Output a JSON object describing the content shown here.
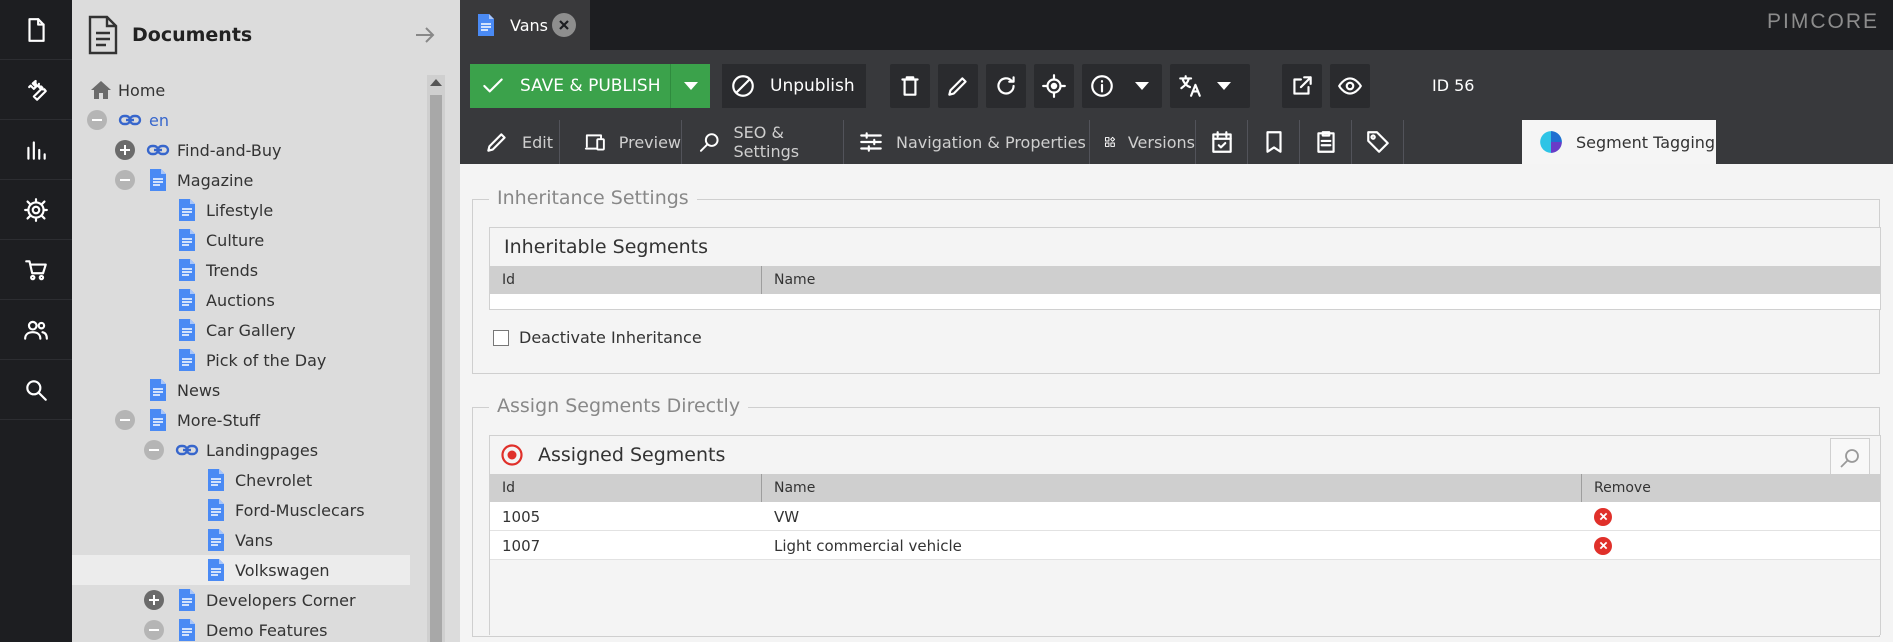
{
  "rail": {
    "items": [
      {
        "name": "documents"
      },
      {
        "name": "tools"
      },
      {
        "name": "marketing"
      },
      {
        "name": "settings"
      },
      {
        "name": "ecommerce"
      },
      {
        "name": "users"
      },
      {
        "name": "search"
      }
    ]
  },
  "tree": {
    "title": "Documents",
    "items": [
      {
        "label": "Home",
        "icon": "home-icon",
        "expander": "none",
        "depth": 0,
        "kind": "home"
      },
      {
        "label": "en",
        "icon": "link-icon",
        "expander": "minus",
        "depth": 0,
        "kind": "link"
      },
      {
        "label": "Find-and-Buy",
        "icon": "link-icon",
        "expander": "plus",
        "depth": 1,
        "kind": "link-dark"
      },
      {
        "label": "Magazine",
        "icon": "page-icon",
        "expander": "minus",
        "depth": 1,
        "kind": "page"
      },
      {
        "label": "Lifestyle",
        "icon": "page-icon",
        "expander": "none",
        "depth": 2,
        "kind": "page"
      },
      {
        "label": "Culture",
        "icon": "page-icon",
        "expander": "none",
        "depth": 2,
        "kind": "page"
      },
      {
        "label": "Trends",
        "icon": "page-icon",
        "expander": "none",
        "depth": 2,
        "kind": "page"
      },
      {
        "label": "Auctions",
        "icon": "page-icon",
        "expander": "none",
        "depth": 2,
        "kind": "page"
      },
      {
        "label": "Car Gallery",
        "icon": "page-icon",
        "expander": "none",
        "depth": 2,
        "kind": "page"
      },
      {
        "label": "Pick of the Day",
        "icon": "page-icon",
        "expander": "none",
        "depth": 2,
        "kind": "page"
      },
      {
        "label": "News",
        "icon": "page-icon",
        "expander": "none",
        "depth": 1,
        "kind": "page"
      },
      {
        "label": "More-Stuff",
        "icon": "page-icon",
        "expander": "minus",
        "depth": 1,
        "kind": "page"
      },
      {
        "label": "Landingpages",
        "icon": "link-icon",
        "expander": "minus",
        "depth": 2,
        "kind": "link-dark"
      },
      {
        "label": "Chevrolet",
        "icon": "page-icon",
        "expander": "none",
        "depth": 3,
        "kind": "page"
      },
      {
        "label": "Ford-Musclecars",
        "icon": "page-icon",
        "expander": "none",
        "depth": 3,
        "kind": "page"
      },
      {
        "label": "Vans",
        "icon": "page-icon",
        "expander": "none",
        "depth": 3,
        "kind": "page"
      },
      {
        "label": "Volkswagen",
        "icon": "page-icon",
        "expander": "none",
        "depth": 3,
        "kind": "page",
        "selected": true
      },
      {
        "label": "Developers Corner",
        "icon": "page-icon",
        "expander": "plus",
        "depth": 2,
        "kind": "page"
      },
      {
        "label": "Demo Features",
        "icon": "page-icon",
        "expander": "minus",
        "depth": 2,
        "kind": "page"
      }
    ]
  },
  "header": {
    "tab_label": "Vans",
    "logo": "PIMCORE"
  },
  "toolbar": {
    "save_label": "SAVE & PUBLISH",
    "unpublish_label": "Unpublish",
    "id_label": "ID 56"
  },
  "subtabs": {
    "edit": "Edit",
    "preview": "Preview",
    "seo": "SEO & Settings",
    "navigation": "Navigation & Properties",
    "versions": "Versions",
    "segment_tagging": "Segment Tagging"
  },
  "inheritance": {
    "legend": "Inheritance Settings",
    "grid_title": "Inheritable Segments",
    "col_id": "Id",
    "col_name": "Name",
    "deactivate_label": "Deactivate Inheritance"
  },
  "assign": {
    "legend": "Assign Segments Directly",
    "grid_title": "Assigned Segments",
    "col_id": "Id",
    "col_name": "Name",
    "col_remove": "Remove",
    "rows": [
      {
        "id": "1005",
        "name": "VW"
      },
      {
        "id": "1007",
        "name": "Light commercial vehicle"
      }
    ]
  },
  "colors": {
    "accent_green": "#3ba24b",
    "dark_bg": "#1d1e21",
    "toolbar_bg": "#38393c",
    "link_blue": "#3766cc",
    "doc_blue": "#4a8af4",
    "remove_red": "#e0302a"
  }
}
